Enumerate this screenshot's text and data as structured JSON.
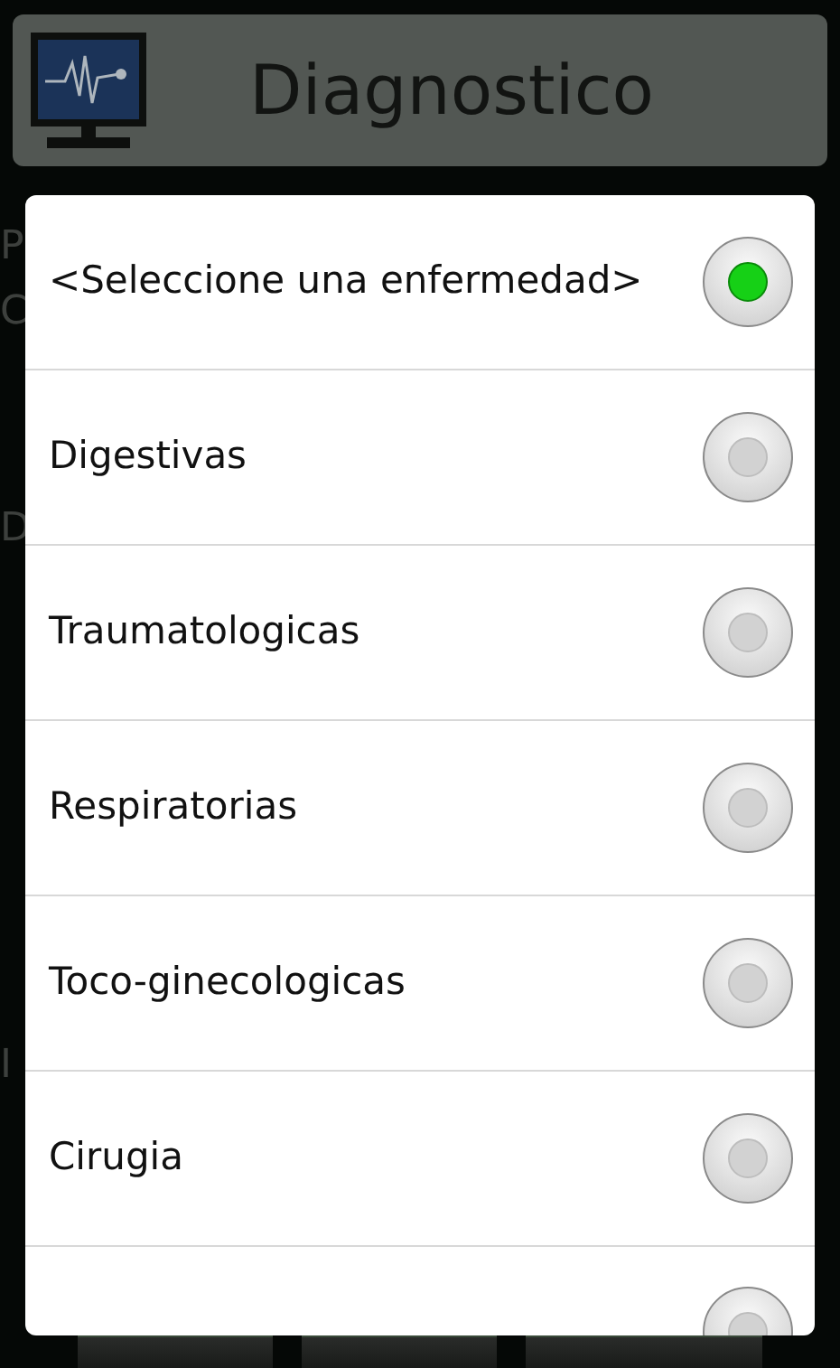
{
  "header": {
    "title": "Diagnostico"
  },
  "background_labels": [
    "P",
    "C",
    "D",
    "I"
  ],
  "dialog": {
    "options": [
      {
        "label": "<Seleccione una enfermedad>",
        "selected": true
      },
      {
        "label": "Digestivas",
        "selected": false
      },
      {
        "label": "Traumatologicas",
        "selected": false
      },
      {
        "label": "Respiratorias",
        "selected": false
      },
      {
        "label": "Toco-ginecologicas",
        "selected": false
      },
      {
        "label": "Cirugia",
        "selected": false
      },
      {
        "selected": false
      }
    ]
  }
}
